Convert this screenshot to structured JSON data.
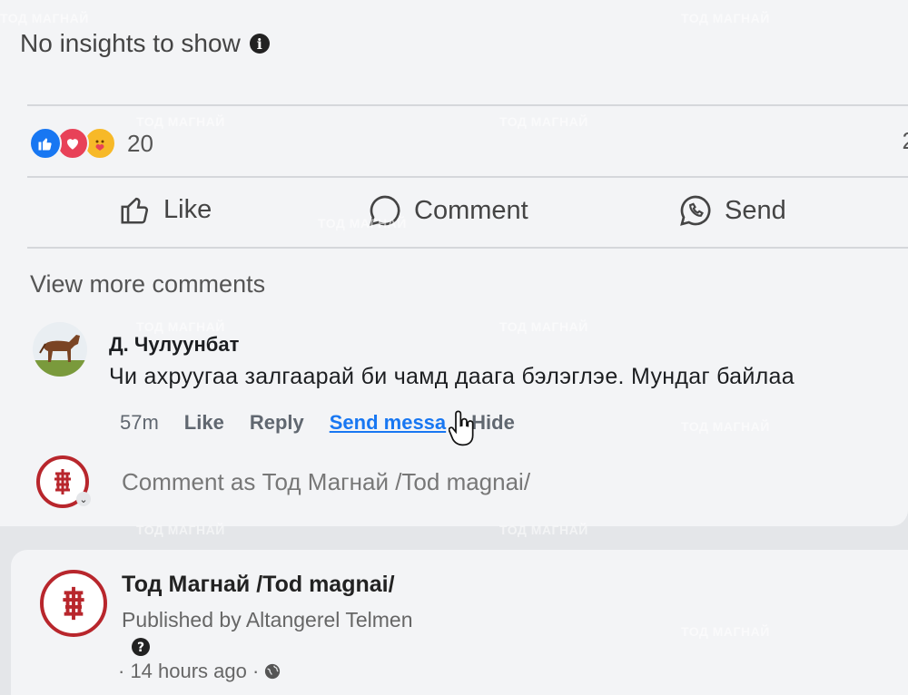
{
  "post": {
    "insights_text": "No insights to show",
    "reaction_count": "20",
    "right_count_partial": "2"
  },
  "actions": {
    "like": "Like",
    "comment": "Comment",
    "send": "Send"
  },
  "comments": {
    "view_more": "View more comments",
    "items": [
      {
        "author": "Д. Чулуунбат",
        "text": "Чи ахруугаа залгаарай би чамд даага бэлэглэе. Мундаг байлаа",
        "time": "57m",
        "like": "Like",
        "reply": "Reply",
        "send_message": "Send messa",
        "hide": "Hide"
      }
    ],
    "compose_placeholder": "Comment as Тод Магнай /Tod magnai/"
  },
  "next_post": {
    "page_name": "Тод Магнай /Tod magnai/",
    "published_by": "Published by Altangerel Telmen",
    "time": "· 14 hours ago ·"
  },
  "watermark": "ТОД МАГНАЙ",
  "colors": {
    "brand_blue": "#1877f2",
    "love_red": "#e84158",
    "care_yellow": "#f7b928",
    "logo_red": "#b8262c"
  },
  "icons": [
    "info-icon",
    "like-reaction-icon",
    "love-reaction-icon",
    "care-reaction-icon",
    "thumbs-up-icon",
    "comment-bubble-icon",
    "messenger-icon",
    "globe-icon",
    "question-icon",
    "hand-cursor-icon",
    "chevron-down-icon"
  ]
}
